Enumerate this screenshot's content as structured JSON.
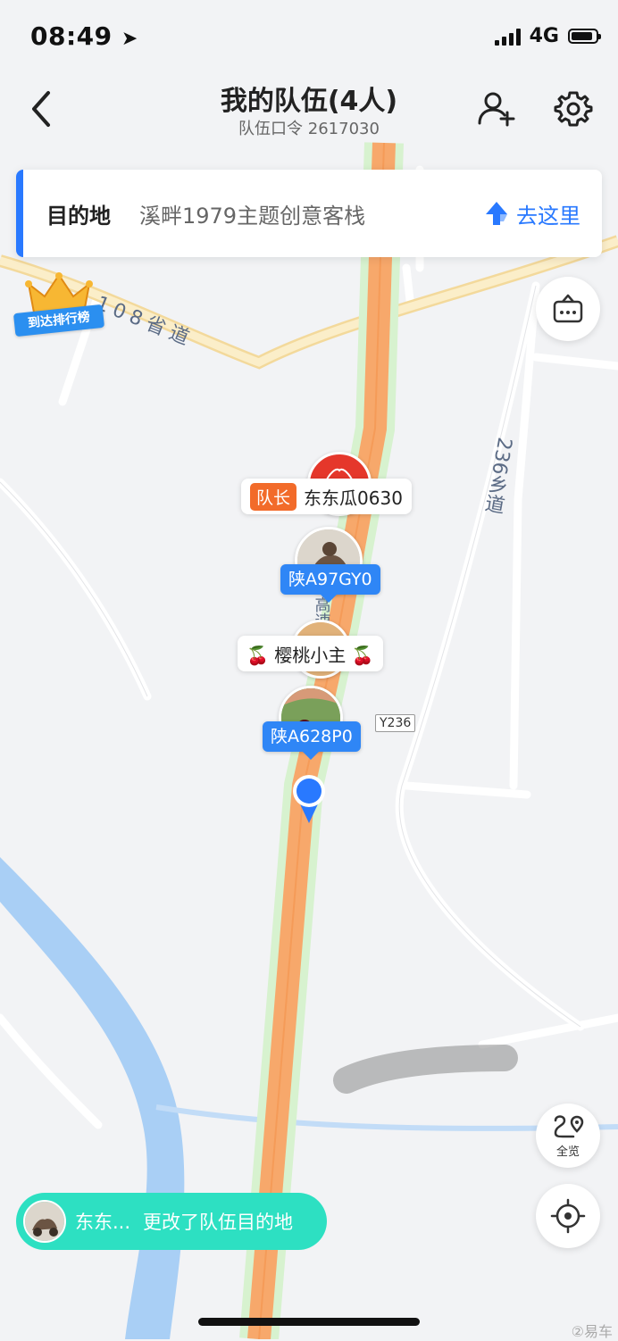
{
  "status": {
    "time": "08:49",
    "network": "4G",
    "battery_level": 0.9
  },
  "header": {
    "title": "我的队伍(4人)",
    "subtitle": "队伍口令 2617030"
  },
  "destination": {
    "label": "目的地",
    "name": "溪畔1979主题创意客栈",
    "goto_label": "去这里"
  },
  "rank_badge": {
    "label": "到达排行榜"
  },
  "map": {
    "road_labels": {
      "provincial": "108省道",
      "township": "236乡道",
      "expressway": "高速",
      "sign": "Y236"
    }
  },
  "members": [
    {
      "leader_tag": "队长",
      "name": "东东瓜0630"
    },
    {
      "plate": "陕A97GY0"
    },
    {
      "name": "🍒 樱桃小主 🍒"
    },
    {
      "plate": "陕A628P0"
    }
  ],
  "controls": {
    "overview_label": "全览"
  },
  "toast": {
    "name": "东东...",
    "message": "更改了队伍目的地"
  },
  "watermark": "②易车",
  "colors": {
    "accent": "#2979ff",
    "route": "#f7a86b",
    "toast": "#2de0c2",
    "leader": "#f26b2a",
    "river": "#a9cff5"
  }
}
